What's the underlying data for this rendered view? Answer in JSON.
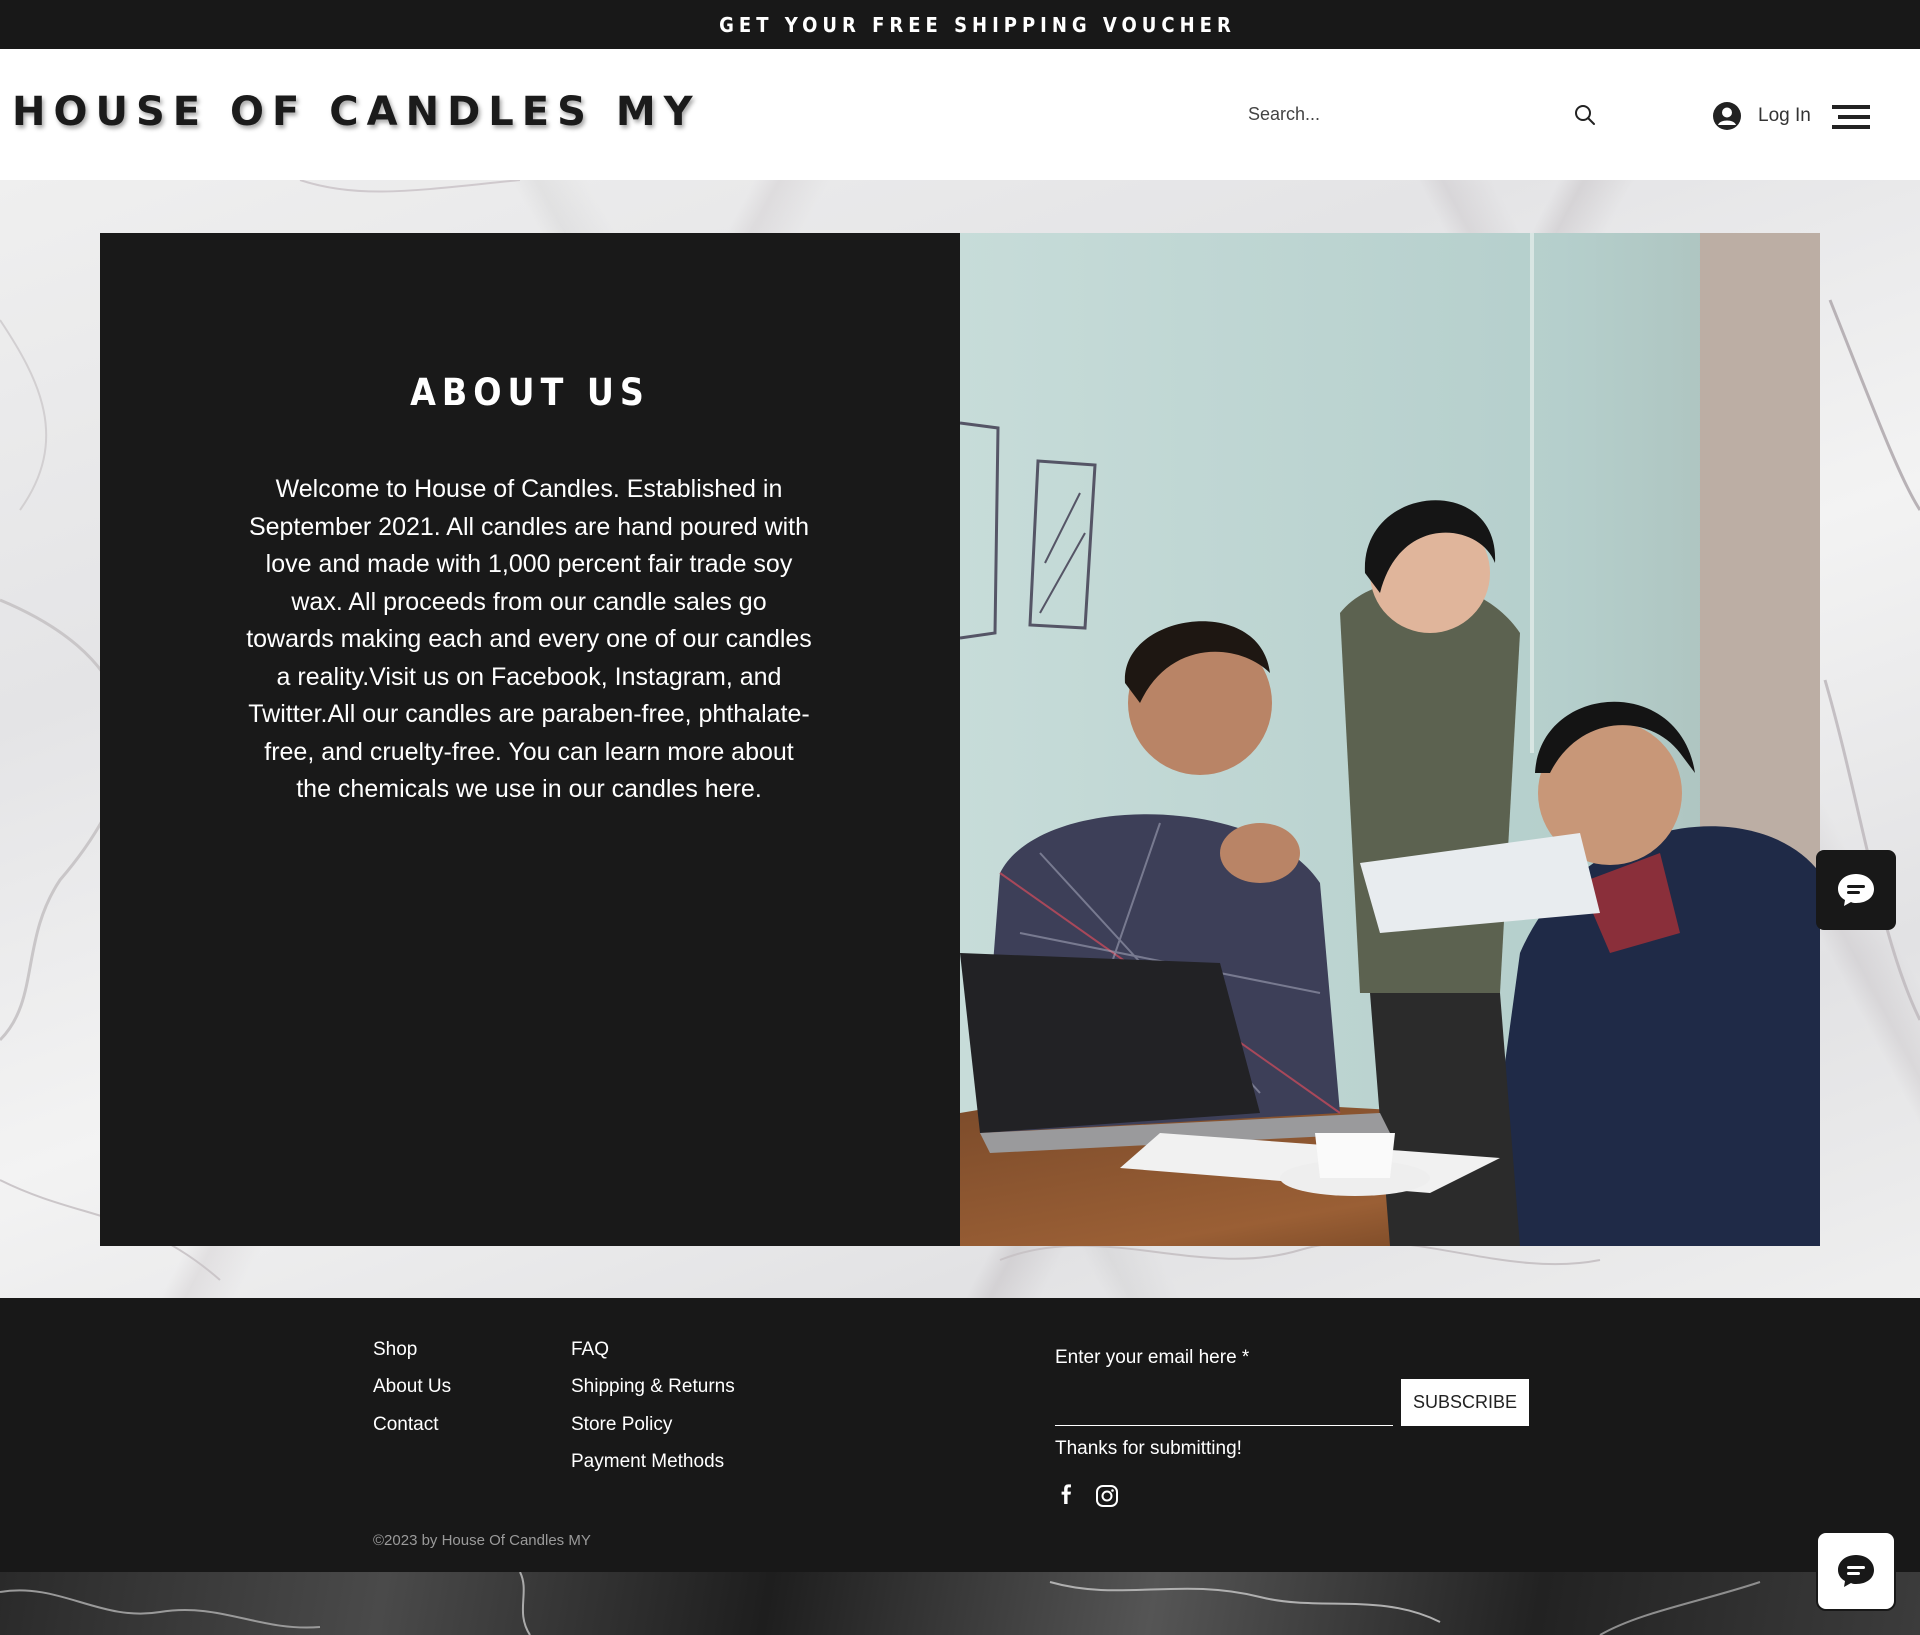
{
  "promo_bar": {
    "text": "GET YOUR FREE SHIPPING VOUCHER"
  },
  "header": {
    "logo": "HOUSE OF CANDLES MY",
    "search_placeholder": "Search...",
    "login_label": "Log In"
  },
  "about": {
    "title": "ABOUT US",
    "body": "Welcome to House of Candles. Established in September 2021. All candles are hand poured with love and made with 1,000 percent fair trade soy wax. All proceeds from our candle sales go towards making each and every one of our candles a reality.Visit us on Facebook, Instagram, and Twitter.All our candles are paraben-free, phthalate-free, and cruelty-free. You can learn more about the chemicals we use in our candles here."
  },
  "footer": {
    "links_col1": [
      "Shop",
      "About Us",
      "Contact"
    ],
    "links_col2": [
      "FAQ",
      "Shipping & Returns",
      "Store Policy",
      "Payment Methods"
    ],
    "email_label": "Enter your email here *",
    "subscribe_label": "SUBSCRIBE",
    "thanks": "Thanks for submitting!",
    "social": [
      "facebook-icon",
      "instagram-icon"
    ],
    "copyright": "©2023 by House Of Candles MY"
  },
  "colors": {
    "dark": "#181818",
    "panel": "#191919",
    "white": "#ffffff",
    "muted": "#9a9a9a"
  }
}
